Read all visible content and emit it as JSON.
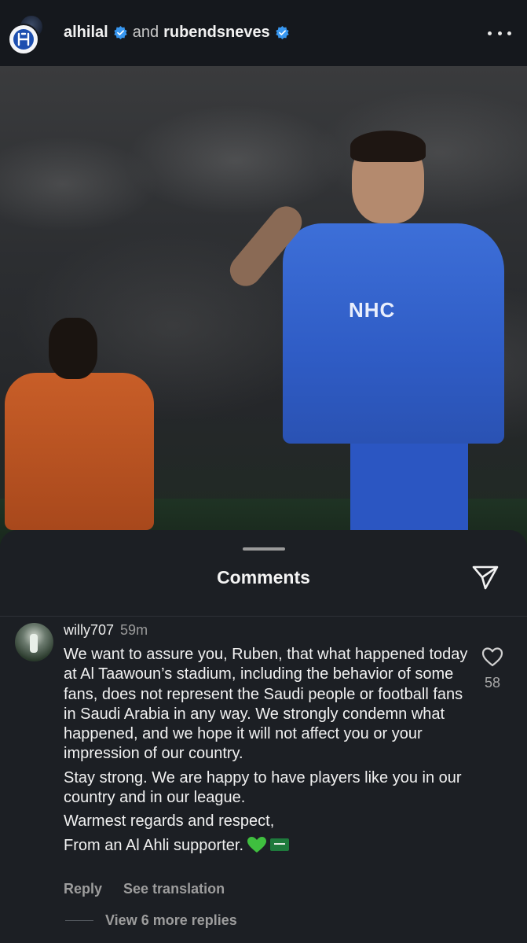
{
  "header": {
    "user1": "alhilal",
    "conjunction": "and",
    "user2": "rubendsneves",
    "more_icon": "more-dots-icon"
  },
  "post": {
    "image_alt": "",
    "shirt_sponsor": "NHC"
  },
  "comments_sheet": {
    "title": "Comments",
    "share_icon": "send-icon"
  },
  "comment": {
    "username": "willy707",
    "time": "59m",
    "paragraphs": [
      "We want to assure you, Ruben, that what happened today at Al Taawoun’s stadium, including the behavior of some fans, does not represent the Saudi people or football fans in Saudi Arabia in any way. We strongly condemn what happened, and we hope it will not affect you or your impression of our country.",
      "Stay strong. We are happy to have players like you in our country and in our league.",
      "Warmest regards and respect,",
      "From an Al Ahli supporter."
    ],
    "emoji": [
      "green-heart-icon",
      "saudi-flag-icon"
    ],
    "like_count": "58",
    "reply_label": "Reply",
    "translate_label": "See translation",
    "view_replies_label": "View 6 more replies"
  }
}
